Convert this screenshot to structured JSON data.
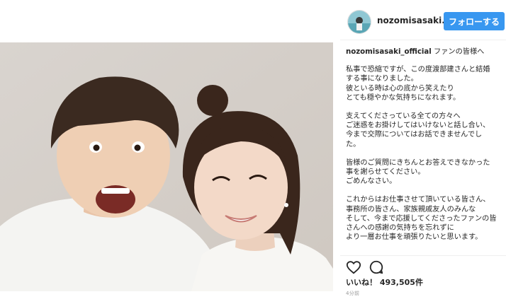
{
  "header": {
    "username": "nozomisasaki...",
    "follow_label": "フォローする",
    "avatar_icon": "profile-avatar-icon"
  },
  "caption": {
    "author": "nozomisasaki_official",
    "title": "ファンの皆様へ",
    "paragraphs": [
      "私事で恐縮ですが、この度渡部建さんと結婚\nする事になりました。\n彼といる時は心の底から笑えたり\nとても穏やかな気持ちになれます。",
      "支えてくださっている全ての方々へ\nご迷惑をお掛けしてはいけないと話し合い、\n今まで交際についてはお話できませんでし\nた。",
      "皆様のご質問にきちんとお答えできなかった\n事を謝らせてください。\nごめんなさい。",
      "これからはお仕事させて頂いている皆さん、\n事務所の皆さん、家族親戚友人のみんな\nそして、今まで応援してくださったファンの皆\nさんへの感謝の気持ちを忘れずに\nより一層お仕事を頑張りたいと思います。"
    ]
  },
  "actions": {
    "like_icon": "heart-icon",
    "comment_icon": "comment-icon"
  },
  "likes": {
    "label": "いいね！",
    "count": "493,505件"
  },
  "time": "4分前",
  "colors": {
    "follow_bg": "#3897f0",
    "text": "#262626",
    "muted": "#999999"
  }
}
